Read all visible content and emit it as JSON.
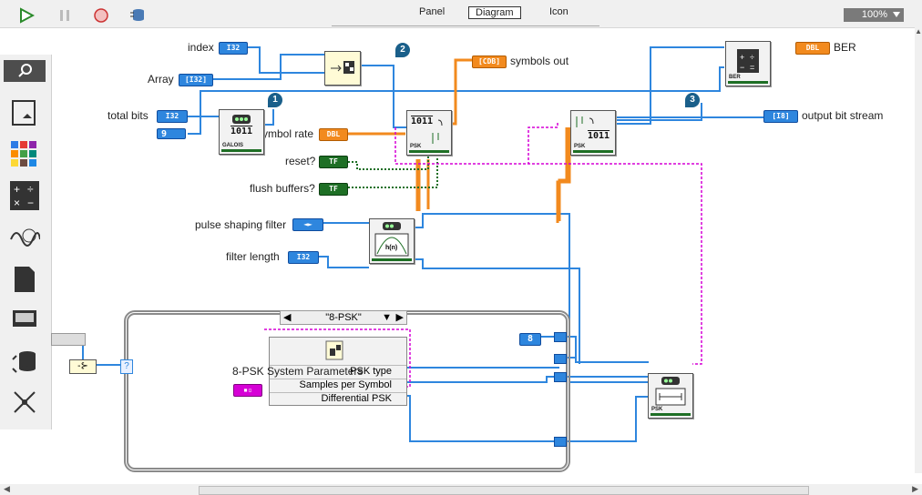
{
  "toolbar": {
    "tabs": [
      "Panel",
      "Diagram",
      "Icon"
    ],
    "active_tab": "Diagram",
    "zoom": "100%"
  },
  "diagram": {
    "labels": {
      "index": "index",
      "array": "Array",
      "total_bits": "total bits",
      "symbol_rate": "symbol rate",
      "reset": "reset?",
      "flush_buffers": "flush buffers?",
      "pulse_shaping_filter": "pulse shaping filter",
      "filter_length": "filter length",
      "symbols_out": "symbols out",
      "ber": "BER",
      "output_bit_stream": "output bit stream"
    },
    "terminals": {
      "index": "I32",
      "array": "[I32]",
      "total_bits": "I32",
      "nine": "9",
      "symbol_rate": "DBL",
      "reset": "TF",
      "flush": "TF",
      "pulse": "◄►",
      "filter_length": "I32",
      "symbols_out": "[CDB]",
      "ber": "DBL",
      "output": "[I8]",
      "eight": "8"
    },
    "markers": [
      "1",
      "2",
      "3"
    ],
    "vi_captions": {
      "galois": "GALOIS",
      "psk_mod": "PSK",
      "psk_demod": "PSK",
      "ber": "BER",
      "psk_params": "PSK"
    },
    "bits_text": "1011",
    "filter_text": "h(n)",
    "case_selector": "\"8-PSK\"",
    "cluster": {
      "title": "8-PSK System Parameters",
      "rows": [
        "PSK type",
        "Samples per Symbol",
        "Differential PSK"
      ]
    },
    "case_tunnel": "?"
  },
  "colors": {
    "wire_blue": "#2e86de",
    "wire_orange": "#f28a1e",
    "wire_green": "#1e6f25",
    "wire_pink": "#d600d6"
  }
}
